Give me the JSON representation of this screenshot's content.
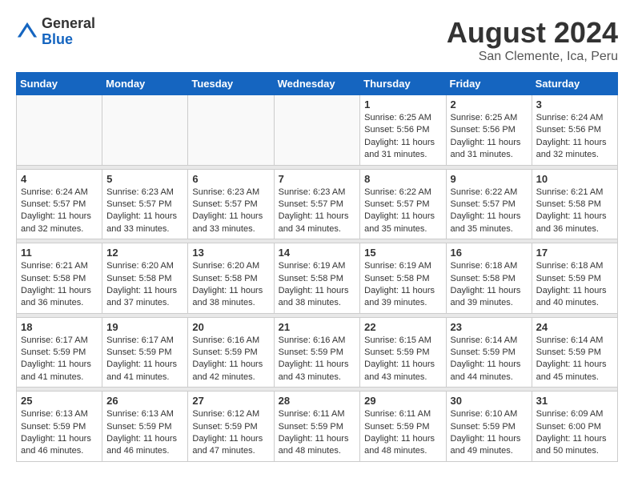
{
  "header": {
    "logo_general": "General",
    "logo_blue": "Blue",
    "month_year": "August 2024",
    "location": "San Clemente, Ica, Peru"
  },
  "weekdays": [
    "Sunday",
    "Monday",
    "Tuesday",
    "Wednesday",
    "Thursday",
    "Friday",
    "Saturday"
  ],
  "weeks": [
    [
      {
        "day": "",
        "empty": true
      },
      {
        "day": "",
        "empty": true
      },
      {
        "day": "",
        "empty": true
      },
      {
        "day": "",
        "empty": true
      },
      {
        "day": "1",
        "sunrise": "6:25 AM",
        "sunset": "5:56 PM",
        "daylight": "11 hours and 31 minutes."
      },
      {
        "day": "2",
        "sunrise": "6:25 AM",
        "sunset": "5:56 PM",
        "daylight": "11 hours and 31 minutes."
      },
      {
        "day": "3",
        "sunrise": "6:24 AM",
        "sunset": "5:56 PM",
        "daylight": "11 hours and 32 minutes."
      }
    ],
    [
      {
        "day": "4",
        "sunrise": "6:24 AM",
        "sunset": "5:57 PM",
        "daylight": "11 hours and 32 minutes."
      },
      {
        "day": "5",
        "sunrise": "6:23 AM",
        "sunset": "5:57 PM",
        "daylight": "11 hours and 33 minutes."
      },
      {
        "day": "6",
        "sunrise": "6:23 AM",
        "sunset": "5:57 PM",
        "daylight": "11 hours and 33 minutes."
      },
      {
        "day": "7",
        "sunrise": "6:23 AM",
        "sunset": "5:57 PM",
        "daylight": "11 hours and 34 minutes."
      },
      {
        "day": "8",
        "sunrise": "6:22 AM",
        "sunset": "5:57 PM",
        "daylight": "11 hours and 35 minutes."
      },
      {
        "day": "9",
        "sunrise": "6:22 AM",
        "sunset": "5:57 PM",
        "daylight": "11 hours and 35 minutes."
      },
      {
        "day": "10",
        "sunrise": "6:21 AM",
        "sunset": "5:58 PM",
        "daylight": "11 hours and 36 minutes."
      }
    ],
    [
      {
        "day": "11",
        "sunrise": "6:21 AM",
        "sunset": "5:58 PM",
        "daylight": "11 hours and 36 minutes."
      },
      {
        "day": "12",
        "sunrise": "6:20 AM",
        "sunset": "5:58 PM",
        "daylight": "11 hours and 37 minutes."
      },
      {
        "day": "13",
        "sunrise": "6:20 AM",
        "sunset": "5:58 PM",
        "daylight": "11 hours and 38 minutes."
      },
      {
        "day": "14",
        "sunrise": "6:19 AM",
        "sunset": "5:58 PM",
        "daylight": "11 hours and 38 minutes."
      },
      {
        "day": "15",
        "sunrise": "6:19 AM",
        "sunset": "5:58 PM",
        "daylight": "11 hours and 39 minutes."
      },
      {
        "day": "16",
        "sunrise": "6:18 AM",
        "sunset": "5:58 PM",
        "daylight": "11 hours and 39 minutes."
      },
      {
        "day": "17",
        "sunrise": "6:18 AM",
        "sunset": "5:59 PM",
        "daylight": "11 hours and 40 minutes."
      }
    ],
    [
      {
        "day": "18",
        "sunrise": "6:17 AM",
        "sunset": "5:59 PM",
        "daylight": "11 hours and 41 minutes."
      },
      {
        "day": "19",
        "sunrise": "6:17 AM",
        "sunset": "5:59 PM",
        "daylight": "11 hours and 41 minutes."
      },
      {
        "day": "20",
        "sunrise": "6:16 AM",
        "sunset": "5:59 PM",
        "daylight": "11 hours and 42 minutes."
      },
      {
        "day": "21",
        "sunrise": "6:16 AM",
        "sunset": "5:59 PM",
        "daylight": "11 hours and 43 minutes."
      },
      {
        "day": "22",
        "sunrise": "6:15 AM",
        "sunset": "5:59 PM",
        "daylight": "11 hours and 43 minutes."
      },
      {
        "day": "23",
        "sunrise": "6:14 AM",
        "sunset": "5:59 PM",
        "daylight": "11 hours and 44 minutes."
      },
      {
        "day": "24",
        "sunrise": "6:14 AM",
        "sunset": "5:59 PM",
        "daylight": "11 hours and 45 minutes."
      }
    ],
    [
      {
        "day": "25",
        "sunrise": "6:13 AM",
        "sunset": "5:59 PM",
        "daylight": "11 hours and 46 minutes."
      },
      {
        "day": "26",
        "sunrise": "6:13 AM",
        "sunset": "5:59 PM",
        "daylight": "11 hours and 46 minutes."
      },
      {
        "day": "27",
        "sunrise": "6:12 AM",
        "sunset": "5:59 PM",
        "daylight": "11 hours and 47 minutes."
      },
      {
        "day": "28",
        "sunrise": "6:11 AM",
        "sunset": "5:59 PM",
        "daylight": "11 hours and 48 minutes."
      },
      {
        "day": "29",
        "sunrise": "6:11 AM",
        "sunset": "5:59 PM",
        "daylight": "11 hours and 48 minutes."
      },
      {
        "day": "30",
        "sunrise": "6:10 AM",
        "sunset": "5:59 PM",
        "daylight": "11 hours and 49 minutes."
      },
      {
        "day": "31",
        "sunrise": "6:09 AM",
        "sunset": "6:00 PM",
        "daylight": "11 hours and 50 minutes."
      }
    ]
  ]
}
